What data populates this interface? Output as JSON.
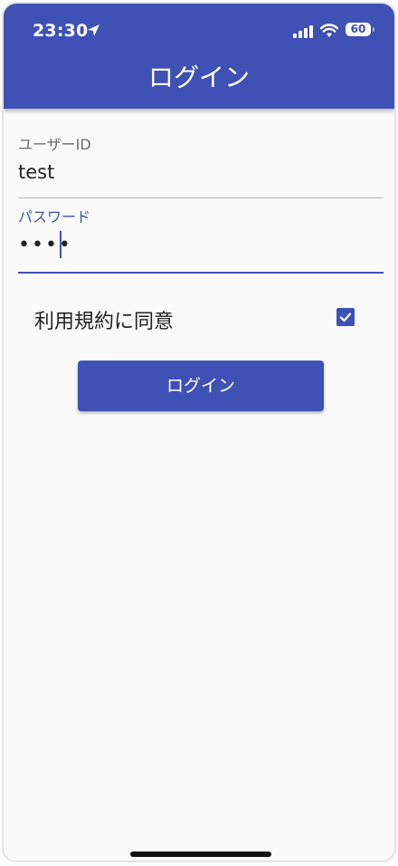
{
  "status_bar": {
    "time": "23:30",
    "location_icon": "location-arrow-icon",
    "signal_icon": "cellular-signal-icon",
    "wifi_icon": "wifi-icon",
    "battery_level": "60"
  },
  "app_bar": {
    "title": "ログイン",
    "color": "#3f51b5"
  },
  "form": {
    "user_id": {
      "label": "ユーザーID",
      "value": "test"
    },
    "password": {
      "label": "パスワード",
      "masked_value": "••••"
    },
    "terms": {
      "label": "利用規約に同意",
      "checked": true
    },
    "login_button_label": "ログイン"
  }
}
